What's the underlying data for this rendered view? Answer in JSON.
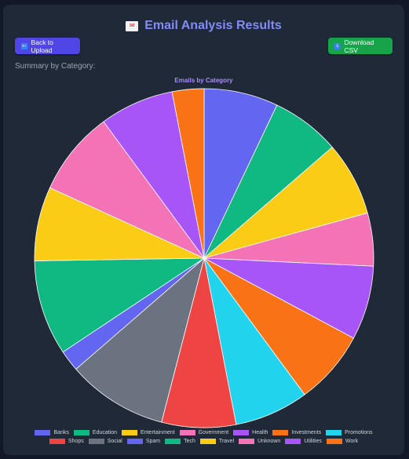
{
  "header": {
    "title": "Email Analysis Results",
    "title_icon": "envelope-icon"
  },
  "toolbar": {
    "back_label": "Back to Upload",
    "back_icon": "arrow-left-icon",
    "download_label": "Download CSV",
    "download_icon": "download-icon"
  },
  "summary": {
    "label": "Summary by Category:"
  },
  "colors": {
    "panel": "#1f2937",
    "title": "#818cf8",
    "back_button": "#4f46e5",
    "download_button": "#16a34a",
    "chart_title": "#a78bfa"
  },
  "chart_data": {
    "type": "pie",
    "title": "Emails by Category",
    "legend_position": "bottom",
    "categories": [
      "Banks",
      "Education",
      "Entertainment",
      "Government",
      "Health",
      "Investments",
      "Promotions",
      "Shops",
      "Social",
      "Spam",
      "Tech",
      "Travel",
      "Unknown",
      "Utilities",
      "Work"
    ],
    "values": [
      7.0,
      6.5,
      7.0,
      5.0,
      7.0,
      7.0,
      7.0,
      7.0,
      9.5,
      2.0,
      9.0,
      7.0,
      8.0,
      7.0,
      3.0
    ],
    "colors": [
      "#6366f1",
      "#10b981",
      "#facc15",
      "#f472b6",
      "#a855f7",
      "#f97316",
      "#22d3ee",
      "#ef4444",
      "#6b7280",
      "#6366f1",
      "#10b981",
      "#facc15",
      "#f472b6",
      "#a855f7",
      "#f97316"
    ]
  }
}
